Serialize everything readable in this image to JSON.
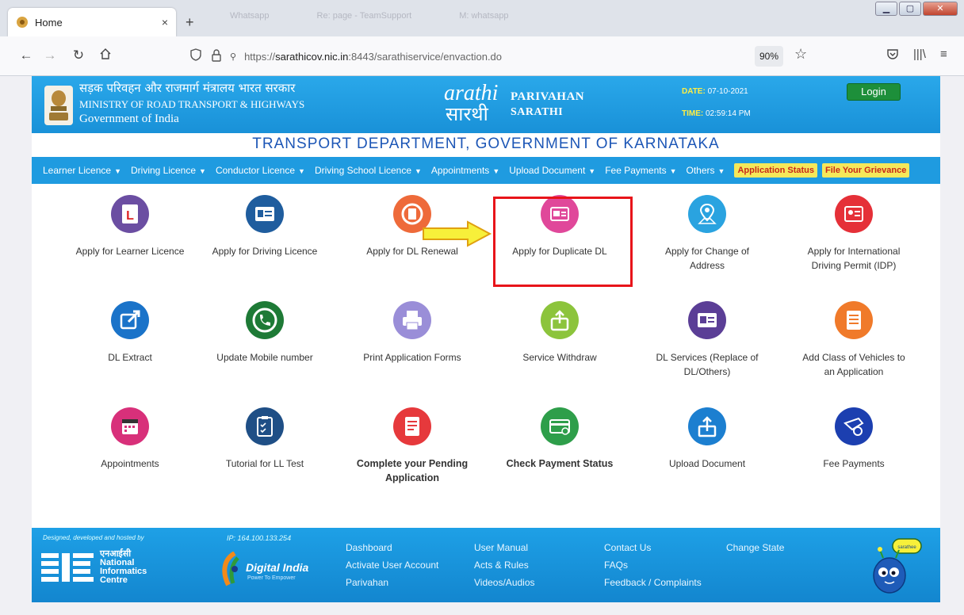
{
  "browser": {
    "tab_title": "Home",
    "tab_close": "×",
    "new_tab": "+",
    "background_tabs": [
      "Whatsapp",
      "Re: page - TeamSupport",
      "M: whatsapp"
    ],
    "url_prefix": "https://",
    "url_host": "sarathicov.nic.in",
    "url_rest": ":8443/sarathiservice/envaction.do",
    "zoom": "90%"
  },
  "header": {
    "ministry_hindi": "सड़क परिवहन और राजमार्ग मंत्रालय भारत सरकार",
    "ministry_english": "MINISTRY OF ROAD TRANSPORT & HIGHWAYS",
    "government": "Government of India",
    "brand_line1": "PARIVAHAN",
    "brand_line2": "SARATHI",
    "date_label": "DATE:",
    "date_value": "07-10-2021",
    "time_label": "TIME:",
    "time_value": "02:59:14 PM",
    "login_label": "Login"
  },
  "department_title": "TRANSPORT DEPARTMENT, GOVERNMENT OF KARNATAKA",
  "menu": {
    "items": [
      "Learner Licence",
      "Driving Licence",
      "Conductor Licence",
      "Driving School Licence",
      "Appointments",
      "Upload Document",
      "Fee Payments",
      "Others"
    ],
    "application_status": "Application Status",
    "file_grievance": "File Your Grievance"
  },
  "services": [
    {
      "line1": "Apply for Learner Licence",
      "line2": "",
      "icon": "learner-licence-icon",
      "color": "#6b4ea2"
    },
    {
      "line1": "Apply for Driving Licence",
      "line2": "",
      "icon": "driving-licence-icon",
      "color": "#1f5d9e"
    },
    {
      "line1": "Apply for DL Renewal",
      "line2": "",
      "icon": "dl-renewal-icon",
      "color": "#ee6a3a"
    },
    {
      "line1": "Apply for Duplicate DL",
      "line2": "",
      "icon": "duplicate-dl-icon",
      "color": "#e0489a"
    },
    {
      "line1": "Apply for Change of",
      "line2": "Address",
      "icon": "change-address-icon",
      "color": "#2aa3e0"
    },
    {
      "line1": "Apply for International",
      "line2": "Driving Permit (IDP)",
      "icon": "idp-icon",
      "color": "#e53038"
    },
    {
      "line1": "DL Extract",
      "line2": "",
      "icon": "dl-extract-icon",
      "color": "#1a73c9"
    },
    {
      "line1": "Update Mobile number",
      "line2": "",
      "icon": "phone-icon",
      "color": "#1e7a36"
    },
    {
      "line1": "Print Application Forms",
      "line2": "",
      "icon": "printer-icon",
      "color": "#9a8ed8"
    },
    {
      "line1": "Service Withdraw",
      "line2": "",
      "icon": "withdraw-icon",
      "color": "#8cc43c"
    },
    {
      "line1": "DL Services (Replace of",
      "line2": "DL/Others)",
      "icon": "dl-services-icon",
      "color": "#5b3e96"
    },
    {
      "line1": "Add Class of Vehicles to",
      "line2": "an Application",
      "icon": "add-class-icon",
      "color": "#f07a2a"
    },
    {
      "line1": "Appointments",
      "line2": "",
      "icon": "calendar-icon",
      "color": "#d8307a"
    },
    {
      "line1": "Tutorial for LL Test",
      "line2": "",
      "icon": "clipboard-icon",
      "color": "#1f4f86"
    },
    {
      "line1": "Complete your Pending",
      "line2": "Application",
      "icon": "pending-application-icon",
      "color": "#e6393c"
    },
    {
      "line1": "Check Payment Status",
      "line2": "",
      "icon": "payment-status-icon",
      "color": "#2e9e4a"
    },
    {
      "line1": "Upload Document",
      "line2": "",
      "icon": "upload-icon",
      "color": "#1c7fd0"
    },
    {
      "line1": "Fee Payments",
      "line2": "",
      "icon": "fee-payment-icon",
      "color": "#1c3fb0"
    }
  ],
  "footer": {
    "designed_by": "Designed, developed and hosted by",
    "ip": "IP: 164.100.133.254",
    "nic_hindi": "एनआईसी",
    "nic_name1": "National",
    "nic_name2": "Informatics",
    "nic_name3": "Centre",
    "digital_india": "Digital India",
    "digital_tagline": "Power To Empower",
    "links": {
      "dashboard": "Dashboard",
      "activate": "Activate User Account",
      "parivahan": "Parivahan",
      "manual": "User Manual",
      "acts": "Acts & Rules",
      "videos": "Videos/Audios",
      "contact": "Contact Us",
      "faqs": "FAQs",
      "feedback": "Feedback / Complaints",
      "change_state": "Change State"
    },
    "mascot_text": "sarathee"
  }
}
